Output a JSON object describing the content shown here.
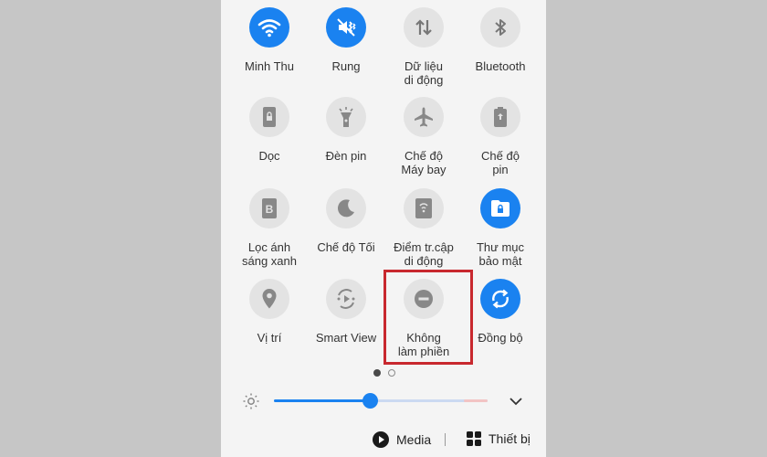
{
  "tiles": [
    {
      "label": "Minh Thu",
      "icon": "wifi-icon",
      "on": true
    },
    {
      "label": "Rung",
      "icon": "vibrate-icon",
      "on": true
    },
    {
      "label": "Dữ liệu\ndi động",
      "icon": "mobile-data-icon",
      "on": false
    },
    {
      "label": "Bluetooth",
      "icon": "bluetooth-icon",
      "on": false
    },
    {
      "label": "Dọc",
      "icon": "portrait-lock-icon",
      "on": false
    },
    {
      "label": "Đèn pin",
      "icon": "flashlight-icon",
      "on": false
    },
    {
      "label": "Chế độ\nMáy bay",
      "icon": "airplane-icon",
      "on": false
    },
    {
      "label": "Chế độ\npin",
      "icon": "battery-saver-icon",
      "on": false
    },
    {
      "label": "Lọc ánh\nsáng xanh",
      "icon": "blue-light-filter-icon",
      "on": false
    },
    {
      "label": "Chế độ Tối",
      "icon": "moon-icon",
      "on": false
    },
    {
      "label": "Điểm tr.cập\ndi động",
      "icon": "hotspot-icon",
      "on": false
    },
    {
      "label": "Thư mục\nbảo mật",
      "icon": "secure-folder-icon",
      "on": true
    },
    {
      "label": "Vị trí",
      "icon": "location-icon",
      "on": false
    },
    {
      "label": "Smart View",
      "icon": "smart-view-icon",
      "on": false
    },
    {
      "label": "Không\nlàm phiền",
      "icon": "do-not-disturb-icon",
      "on": false
    },
    {
      "label": "Đồng bộ",
      "icon": "sync-icon",
      "on": true
    }
  ],
  "page_indicator": {
    "current": 1,
    "total": 2
  },
  "brightness": {
    "level": 0.45
  },
  "bottom_bar": {
    "media_label": "Media",
    "devices_label": "Thiết bị"
  },
  "colors": {
    "accent": "#1a82f0",
    "highlight": "#c8282e"
  }
}
